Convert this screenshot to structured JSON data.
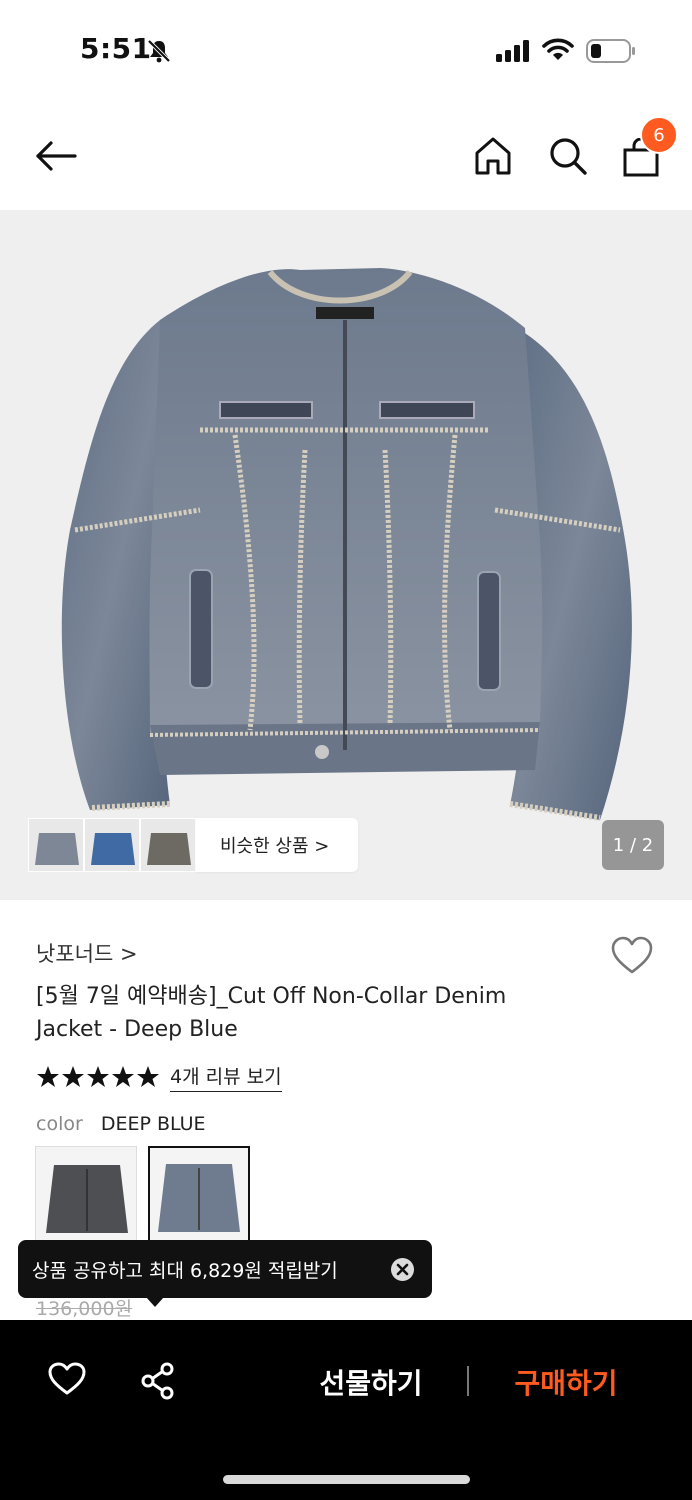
{
  "status_bar": {
    "time": "5:51"
  },
  "header": {
    "cart_count": "6"
  },
  "gallery": {
    "similar_label": "비슷한 상품 >",
    "counter": "1 / 2"
  },
  "product": {
    "brand": "낫포너드 >",
    "title": "[5월 7일 예약배송]_Cut Off Non-Collar Denim Jacket - Deep Blue",
    "rating_stars": 5,
    "review_link": "4개 리뷰 보기",
    "option_label": "color",
    "option_value": "DEEP BLUE",
    "original_price": "136,000원"
  },
  "toast": {
    "text": "상품 공유하고 최대 6,829원 적립받기"
  },
  "bottom_bar": {
    "gift_label": "선물하기",
    "buy_label": "구매하기"
  },
  "colors": {
    "accent": "#ff5a1f",
    "bar": "#000000"
  }
}
